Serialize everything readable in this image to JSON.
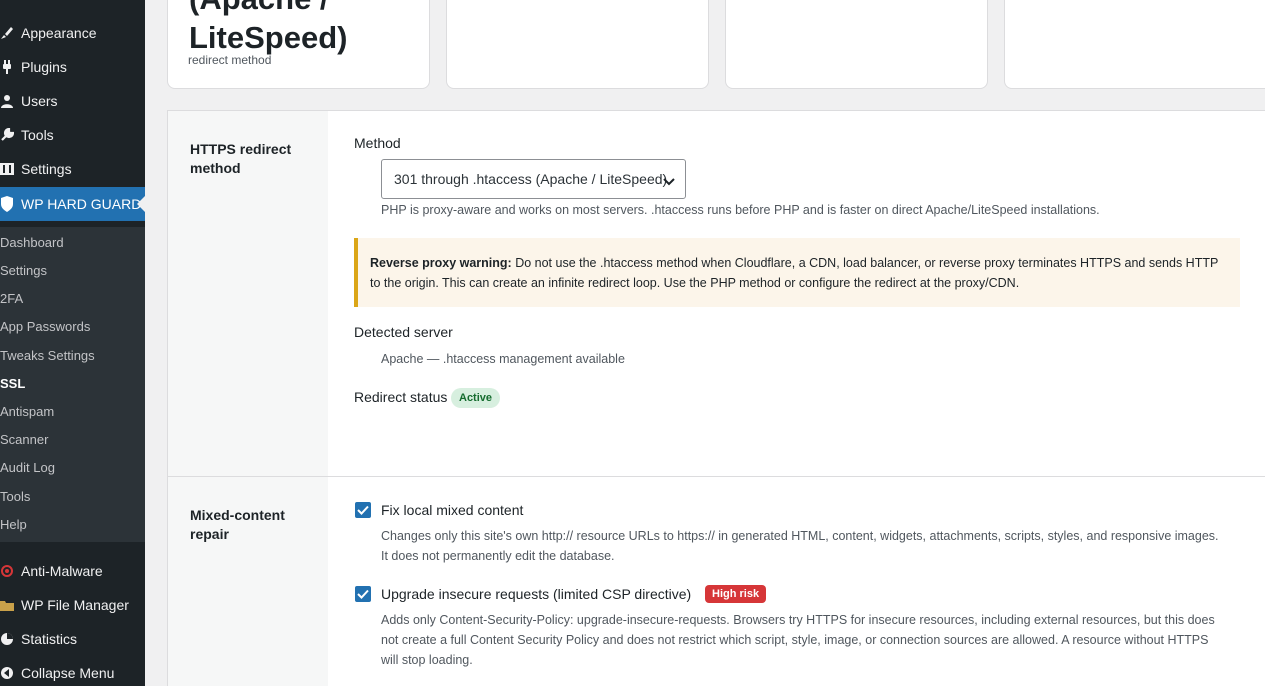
{
  "sidebar": {
    "menu": [
      {
        "label": "Appearance",
        "icon": "paintbrush-icon"
      },
      {
        "label": "Plugins",
        "icon": "plug-icon"
      },
      {
        "label": "Users",
        "icon": "user-icon"
      },
      {
        "label": "Tools",
        "icon": "wrench-icon"
      },
      {
        "label": "Settings",
        "icon": "sliders-icon"
      },
      {
        "label": "WP HARD GUARD",
        "icon": "shield-icon"
      }
    ],
    "submenu": [
      "Dashboard",
      "Settings",
      "2FA",
      "App Passwords",
      "Tweaks Settings",
      "SSL",
      "Antispam",
      "Scanner",
      "Audit Log",
      "Tools",
      "Help"
    ],
    "submenu_current": "SSL",
    "bottom_menu": [
      {
        "label": "Anti-Malware",
        "icon": "virus-icon"
      },
      {
        "label": "WP File Manager",
        "icon": "folder-icon"
      },
      {
        "label": "Statistics",
        "icon": "pie-chart-icon"
      },
      {
        "label": "Collapse Menu",
        "icon": "collapse-icon"
      }
    ],
    "colors": {
      "bg": "#1d2327",
      "submenu_bg": "#2c3338",
      "active": "#2271b1"
    }
  },
  "cards": {
    "first": {
      "big_line1": "(Apache /",
      "big_line2": "LiteSpeed)",
      "sub": "redirect method"
    }
  },
  "https_section": {
    "title": "HTTPS redirect method",
    "method_label": "Method",
    "method_value": "301 through .htaccess (Apache / LiteSpeed)",
    "method_help": "PHP is proxy-aware and works on most servers. .htaccess runs before PHP and is faster on direct Apache/LiteSpeed installations.",
    "warning_bold": "Reverse proxy warning:",
    "warning_text": " Do not use the .htaccess method when Cloudflare, a CDN, load balancer, or reverse proxy terminates HTTPS and sends HTTP to the origin. This can create an infinite redirect loop. Use the PHP method or configure the redirect at the proxy/CDN.",
    "detected_label": "Detected server",
    "detected_value": "Apache — .htaccess management available",
    "status_label": "Redirect status",
    "status_badge": "Active"
  },
  "mixed_section": {
    "title": "Mixed-content repair",
    "fix_label": "Fix local mixed content",
    "fix_checked": true,
    "fix_help": "Changes only this site's own http:// resource URLs to https:// in generated HTML, content, widgets, attachments, scripts, styles, and responsive images. It does not permanently edit the database.",
    "upgrade_label": "Upgrade insecure requests (limited CSP directive)",
    "upgrade_checked": true,
    "upgrade_badge": "High risk",
    "upgrade_help": "Adds only Content-Security-Policy: upgrade-insecure-requests. Browsers try HTTPS for insecure resources, including external resources, but this does not create a full Content Security Policy and does not restrict which script, style, image, or connection sources are allowed. A resource without HTTPS will stop loading."
  }
}
